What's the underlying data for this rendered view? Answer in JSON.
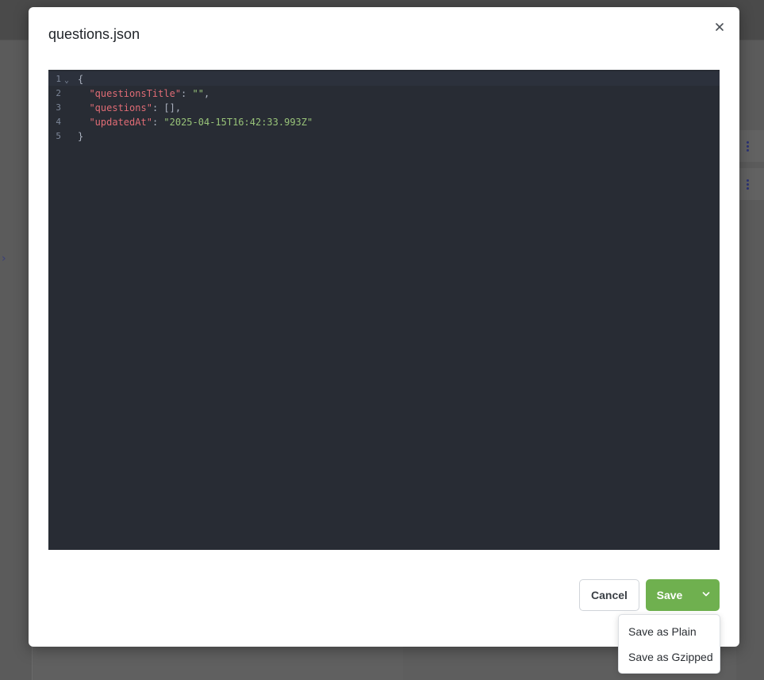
{
  "dialog": {
    "title": "questions.json",
    "close_icon": "close-icon"
  },
  "editor": {
    "lines": [
      {
        "number": "1",
        "fold": "⌄",
        "parts": [
          {
            "t": "{",
            "c": "punc"
          }
        ]
      },
      {
        "number": "2",
        "parts": [
          {
            "t": "  ",
            "c": "punc"
          },
          {
            "t": "\"questionsTitle\"",
            "c": "key"
          },
          {
            "t": ": ",
            "c": "punc"
          },
          {
            "t": "\"\"",
            "c": "str"
          },
          {
            "t": ",",
            "c": "punc"
          }
        ]
      },
      {
        "number": "3",
        "parts": [
          {
            "t": "  ",
            "c": "punc"
          },
          {
            "t": "\"questions\"",
            "c": "key"
          },
          {
            "t": ": [],",
            "c": "punc"
          }
        ]
      },
      {
        "number": "4",
        "parts": [
          {
            "t": "  ",
            "c": "punc"
          },
          {
            "t": "\"updatedAt\"",
            "c": "key"
          },
          {
            "t": ": ",
            "c": "punc"
          },
          {
            "t": "\"2025-04-15T16:42:33.993Z\"",
            "c": "str"
          }
        ]
      },
      {
        "number": "5",
        "parts": [
          {
            "t": "}",
            "c": "punc"
          }
        ]
      }
    ],
    "colors": {
      "background": "#282c34",
      "key": "#e06c75",
      "string": "#98c379",
      "punctuation": "#abb2bf",
      "line_number": "#7d8799"
    }
  },
  "footer": {
    "cancel_label": "Cancel",
    "save_label": "Save",
    "save_menu_icon": "chevron-down-icon",
    "save_color": "#6fb04f",
    "save_options": [
      "Save as Plain",
      "Save as Gzipped"
    ]
  }
}
